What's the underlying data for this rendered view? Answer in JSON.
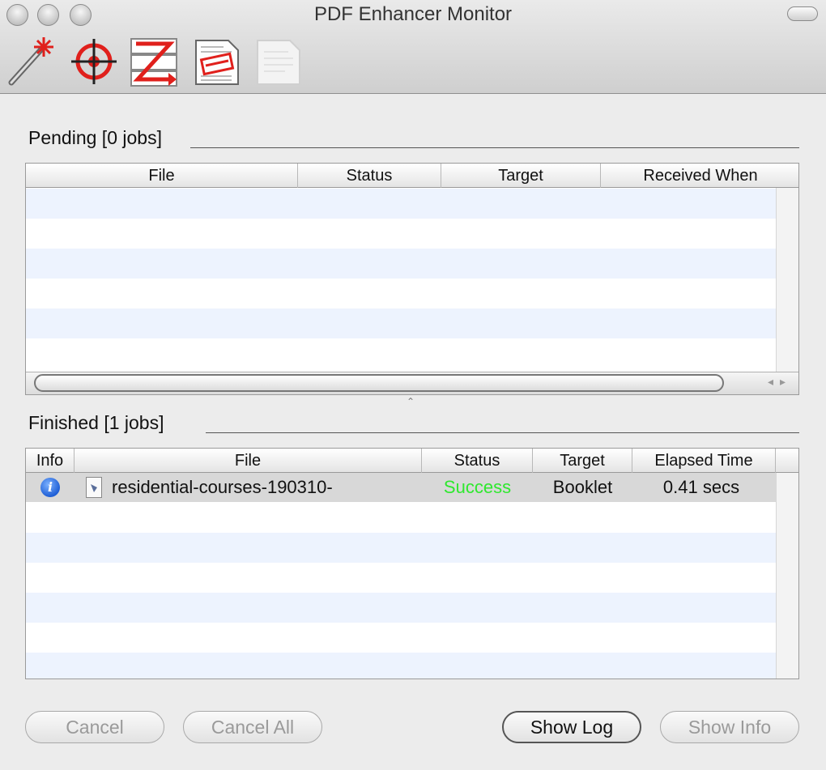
{
  "window": {
    "title": "PDF Enhancer Monitor"
  },
  "toolbar": {
    "items": [
      {
        "icon": "magic-wand-icon"
      },
      {
        "icon": "crosshair-target-icon"
      },
      {
        "icon": "z-fold-icon"
      },
      {
        "icon": "stamp-document-icon"
      },
      {
        "icon": "blank-document-icon"
      }
    ]
  },
  "pending": {
    "label": "Pending [0 jobs]",
    "columns": [
      "File",
      "Status",
      "Target",
      "Received When"
    ]
  },
  "finished": {
    "label": "Finished [1 jobs]",
    "columns": [
      "Info",
      "File",
      "Status",
      "Target",
      "Elapsed Time"
    ],
    "rows": [
      {
        "file": "residential-courses-190310-",
        "status": "Success",
        "target": "Booklet",
        "elapsed": "0.41 secs"
      }
    ]
  },
  "colors": {
    "success": "#2ee82e",
    "stripe": "#edf3fe",
    "accent_red": "#e0201c"
  },
  "buttons": {
    "cancel": "Cancel",
    "cancel_all": "Cancel All",
    "show_log": "Show Log",
    "show_info": "Show Info"
  }
}
